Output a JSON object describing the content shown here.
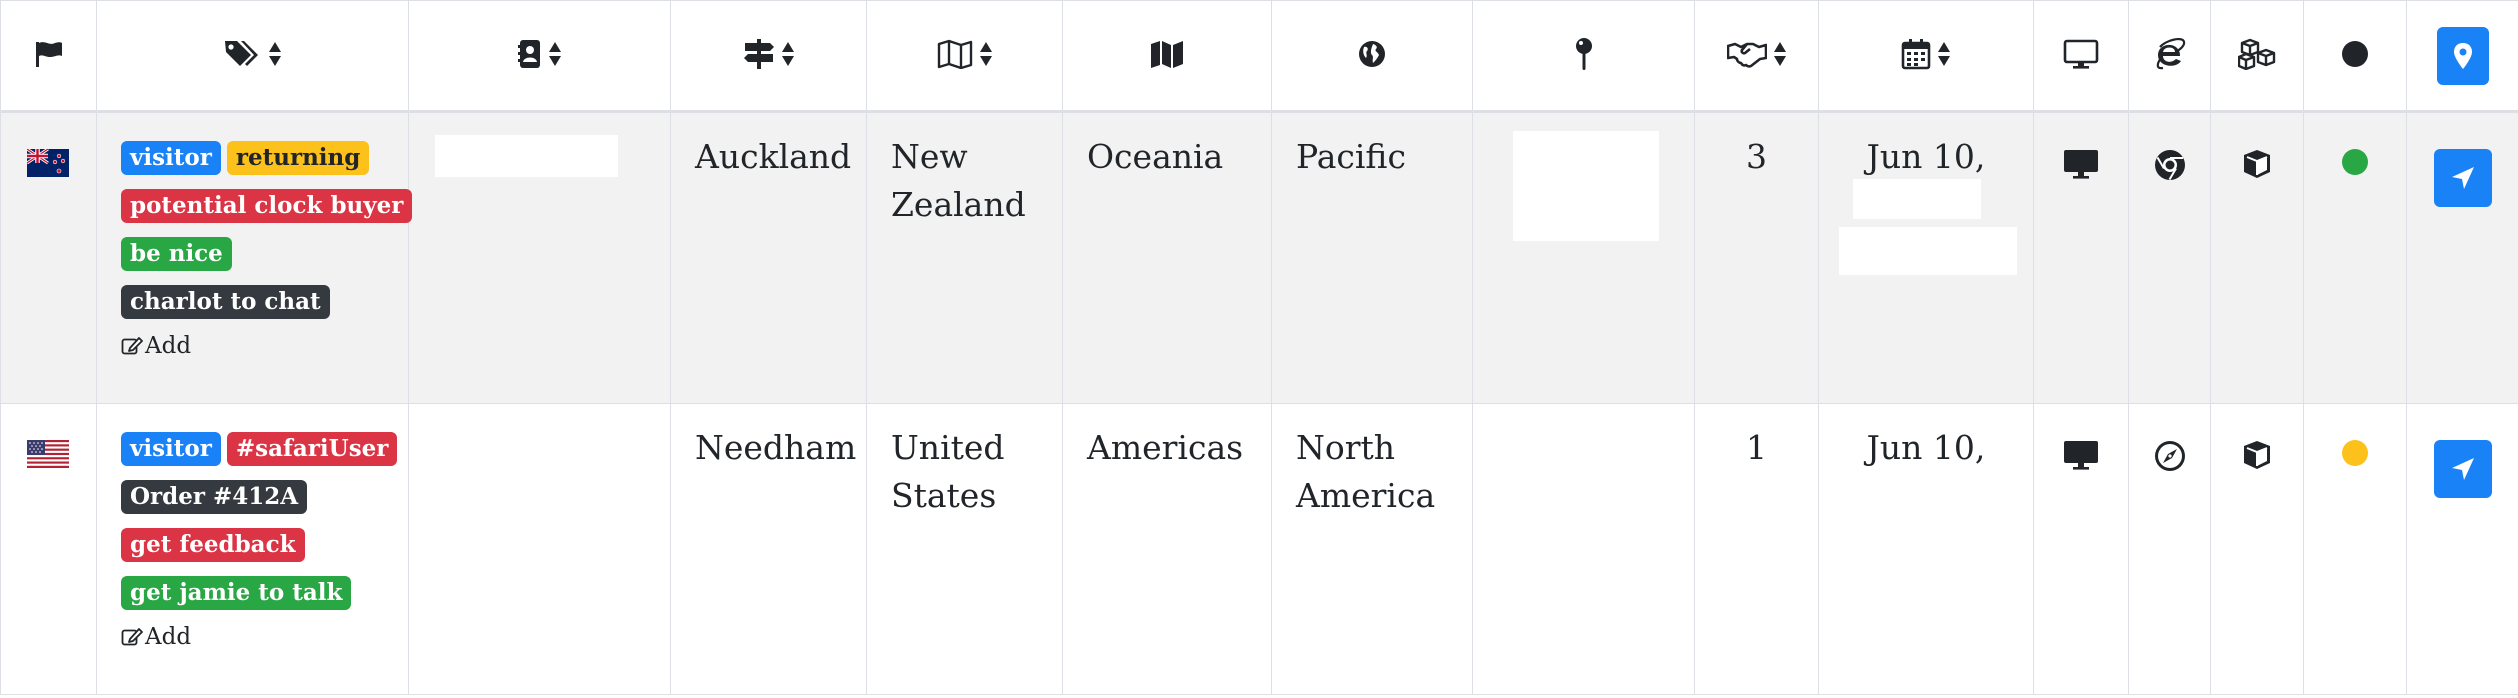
{
  "header": {
    "columns": [
      {
        "icon": "flag-icon",
        "sortable": false
      },
      {
        "icon": "tags-icon",
        "sortable": true
      },
      {
        "icon": "contact-card-icon",
        "sortable": true
      },
      {
        "icon": "signpost-icon",
        "sortable": true
      },
      {
        "icon": "folded-map-icon",
        "sortable": true
      },
      {
        "icon": "map-icon",
        "sortable": false
      },
      {
        "icon": "globe-icon",
        "sortable": false
      },
      {
        "icon": "map-pin-icon",
        "sortable": false
      },
      {
        "icon": "handshake-icon",
        "sortable": true
      },
      {
        "icon": "calendar-icon",
        "sortable": true
      },
      {
        "icon": "desktop-icon",
        "sortable": false
      },
      {
        "icon": "internet-explorer-icon",
        "sortable": false
      },
      {
        "icon": "cubes-icon",
        "sortable": false
      },
      {
        "icon": "status-circle-icon",
        "sortable": false
      },
      {
        "icon": "map-marker-button-icon",
        "sortable": false
      }
    ]
  },
  "rows": [
    {
      "flag": "new-zealand-flag-icon",
      "tags": [
        {
          "label": "visitor",
          "color": "#1a82f7"
        },
        {
          "label": "returning",
          "color": "#fcc11b"
        },
        {
          "label": "potential clock buyer",
          "color": "#db3545"
        },
        {
          "label": "be nice",
          "color": "#2aa745"
        },
        {
          "label": "charlot to chat",
          "color": "#343a40"
        }
      ],
      "add_label": "Add",
      "city": "Auckland",
      "country": "New Zealand",
      "continent": "Oceania",
      "region": "Pacific",
      "visits": "3",
      "date": "Jun 10,",
      "device_icon": "desktop-icon",
      "browser_icon": "chrome-icon",
      "os_icon": "cube-icon",
      "status_color": "#2aa745"
    },
    {
      "flag": "united-states-flag-icon",
      "tags": [
        {
          "label": "visitor",
          "color": "#1a82f7"
        },
        {
          "label": "#safariUser",
          "color": "#db3545"
        },
        {
          "label": "Order #412A",
          "color": "#343a40"
        },
        {
          "label": "get feedback",
          "color": "#db3545"
        },
        {
          "label": "get jamie to talk",
          "color": "#2aa745"
        }
      ],
      "add_label": "Add",
      "city": "Needham",
      "country": "United States",
      "continent": "Americas",
      "region": "North America",
      "visits": "1",
      "date": "Jun 10,",
      "device_icon": "desktop-icon",
      "browser_icon": "safari-compass-icon",
      "os_icon": "cube-icon",
      "status_color": "#fcc11b"
    }
  ]
}
